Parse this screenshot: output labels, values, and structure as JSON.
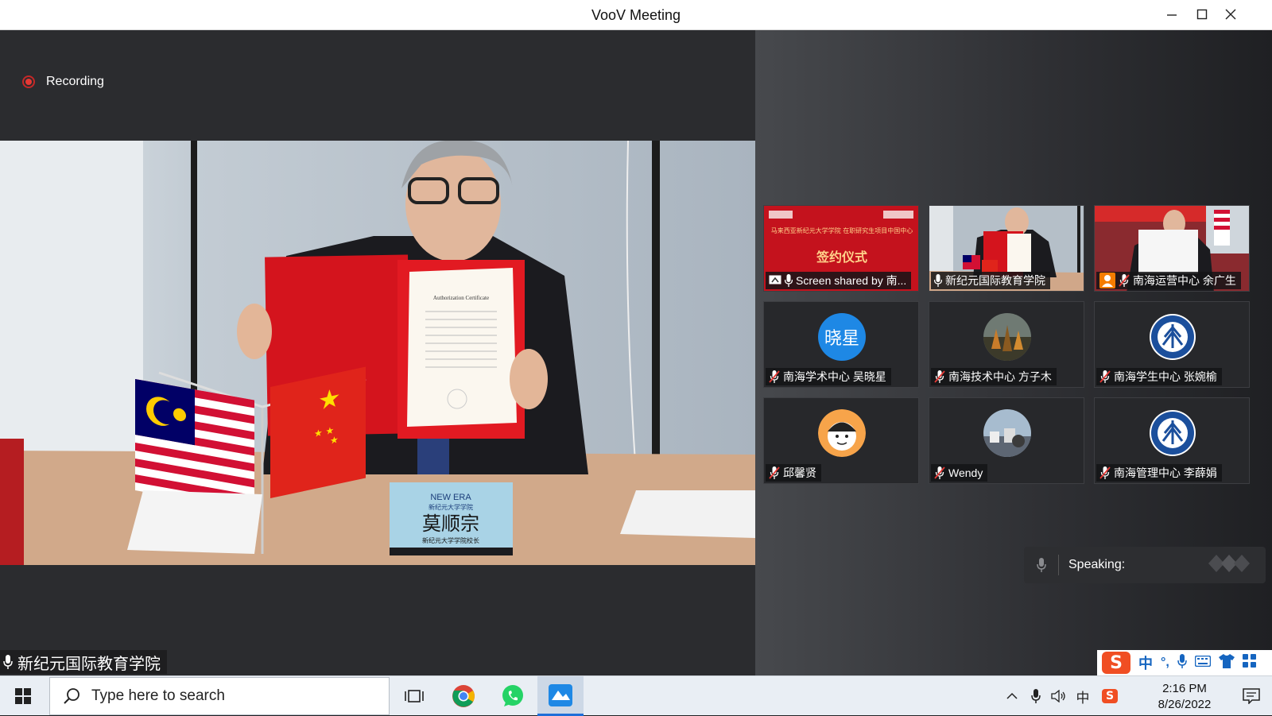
{
  "window": {
    "title": "VooV Meeting"
  },
  "main": {
    "recording_label": "Recording",
    "active_speaker_name": "新纪元国际教育学院"
  },
  "video": {
    "certificate_heading": "Authorization Certificate",
    "nameplate_brand": "NEW ERA",
    "nameplate_sub": "新纪元大学学院",
    "nameplate_name": "莫顺宗",
    "nameplate_title": "新纪元大学学院校长"
  },
  "participants": [
    {
      "label": "Screen shared by 南...",
      "slide_title": "签约仪式",
      "slide_sub": "马来西亚新纪元大学学院 在职研究生项目中国中心",
      "type": "share"
    },
    {
      "label": "新纪元国际教育学院",
      "type": "video"
    },
    {
      "label": "南海运营中心 余广生",
      "type": "video"
    },
    {
      "label": "南海学术中心 吴晓星",
      "avatar_text": "晓星",
      "type": "avatar"
    },
    {
      "label": "南海技术中心 方子木",
      "type": "avatar"
    },
    {
      "label": "南海学生中心 张婉榆",
      "type": "avatar"
    },
    {
      "label": "邱馨贤",
      "type": "avatar"
    },
    {
      "label": "Wendy",
      "type": "avatar"
    },
    {
      "label": "南海管理中心 李薛娟",
      "type": "avatar"
    }
  ],
  "speaking": {
    "label": "Speaking:"
  },
  "ime": {
    "lang": "中",
    "punct": "°,"
  },
  "taskbar": {
    "search_placeholder": "Type here to search",
    "tray_lang": "中",
    "time": "2:16 PM",
    "date": "8/26/2022"
  },
  "colors": {
    "accent_blue": "#1e88e5",
    "record_red": "#e53935",
    "flag_red": "#e0241b"
  }
}
